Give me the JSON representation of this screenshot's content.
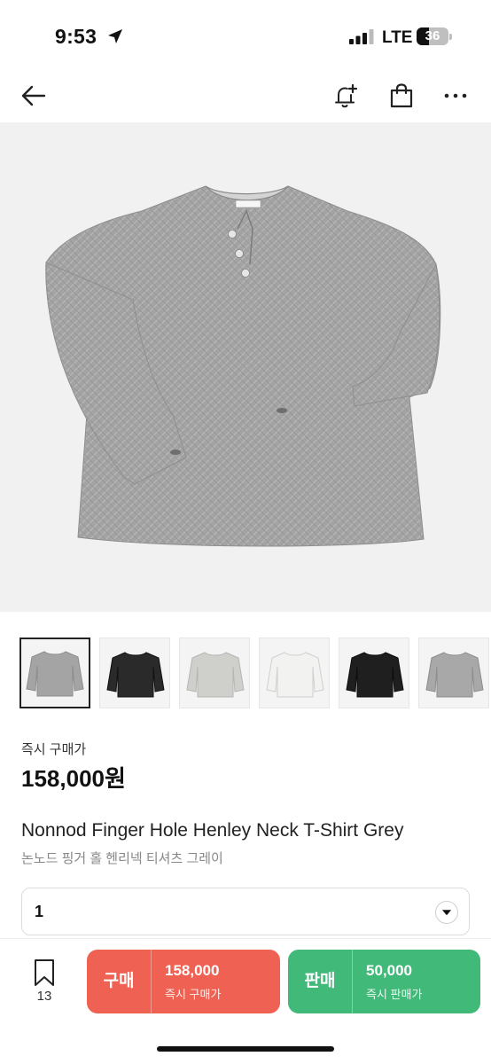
{
  "status_bar": {
    "time": "9:53",
    "network": "LTE",
    "battery": "36"
  },
  "nav": {
    "back_icon": "arrow-left-icon",
    "alert_icon": "bell-plus-icon",
    "bag_icon": "shopping-bag-icon",
    "more_icon": "more-horizontal-icon"
  },
  "product": {
    "price_label": "즉시 구매가",
    "price": "158,000원",
    "name_en": "Nonnod Finger Hole Henley Neck T-Shirt Grey",
    "name_ko": "논노드 핑거 홀 헨리넥 티셔츠 그레이",
    "thumbnail_colors": [
      "grey",
      "black",
      "light-grey",
      "white",
      "black",
      "grey"
    ]
  },
  "size_select": {
    "value": "1"
  },
  "bottom_bar": {
    "wish_count": "13",
    "buy": {
      "label": "구매",
      "amount": "158,000",
      "sub": "즉시 구매가"
    },
    "sell": {
      "label": "판매",
      "amount": "50,000",
      "sub": "즉시 판매가"
    }
  },
  "colors": {
    "buy": "#ef6253",
    "sell": "#41b979"
  }
}
